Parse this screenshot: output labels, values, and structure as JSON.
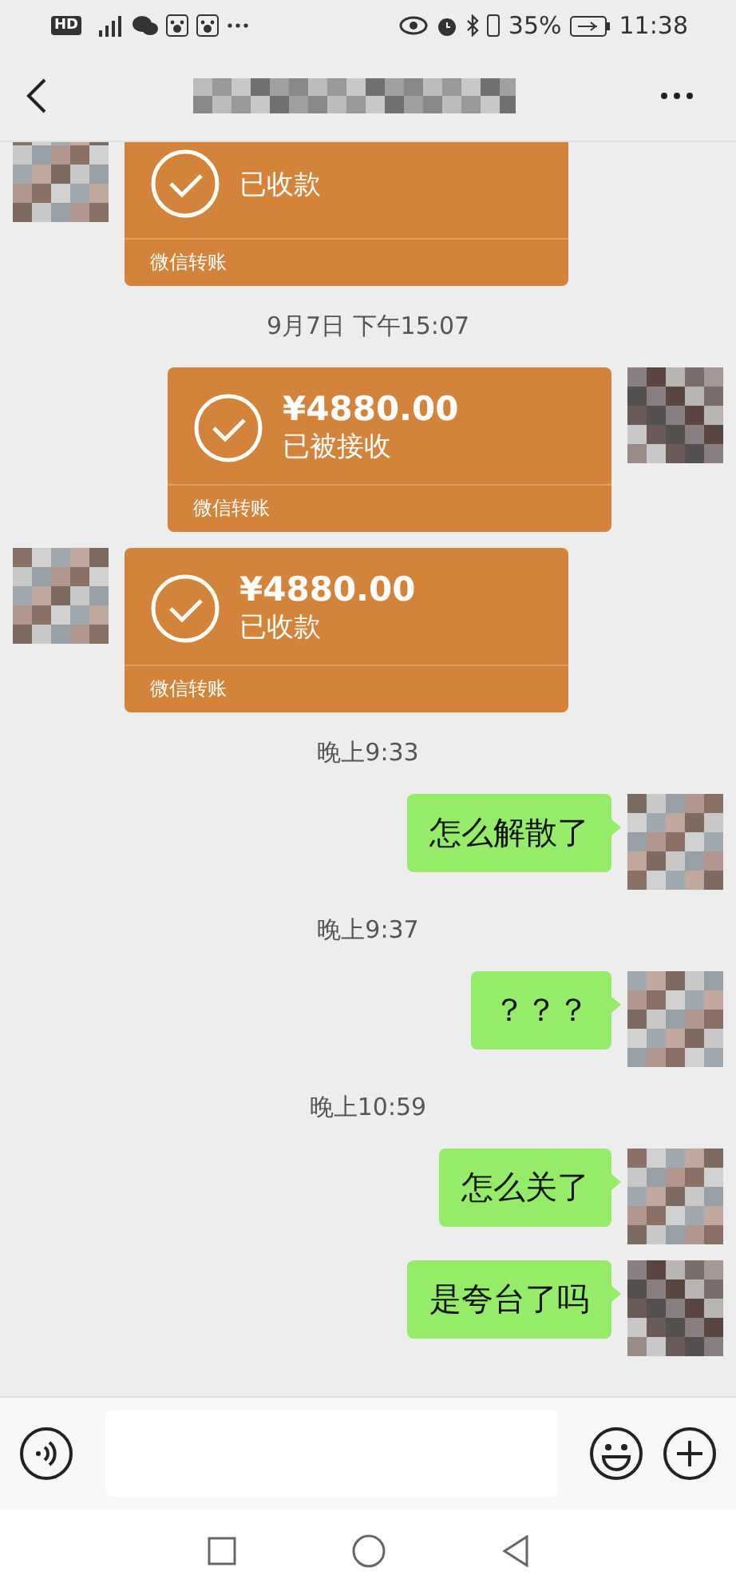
{
  "status_bar": {
    "badge": "HD",
    "battery": "35%",
    "time": "11:38"
  },
  "messages": [
    {
      "kind": "transfer",
      "outgoing": false,
      "status": "已收款",
      "label": "微信转账"
    },
    {
      "kind": "time",
      "text": "9月7日 下午15:07"
    },
    {
      "kind": "transfer",
      "outgoing": true,
      "amount": "¥4880.00",
      "status": "已被接收",
      "label": "微信转账"
    },
    {
      "kind": "transfer",
      "outgoing": false,
      "amount": "¥4880.00",
      "status": "已收款",
      "label": "微信转账"
    },
    {
      "kind": "time",
      "text": "晚上9:33"
    },
    {
      "kind": "text",
      "outgoing": true,
      "text": "怎么解散了"
    },
    {
      "kind": "time",
      "text": "晚上9:37"
    },
    {
      "kind": "text",
      "outgoing": true,
      "text": "？？？"
    },
    {
      "kind": "time",
      "text": "晚上10:59"
    },
    {
      "kind": "text",
      "outgoing": true,
      "text": "怎么关了"
    },
    {
      "kind": "text",
      "outgoing": true,
      "text": "是夸台了吗"
    }
  ]
}
